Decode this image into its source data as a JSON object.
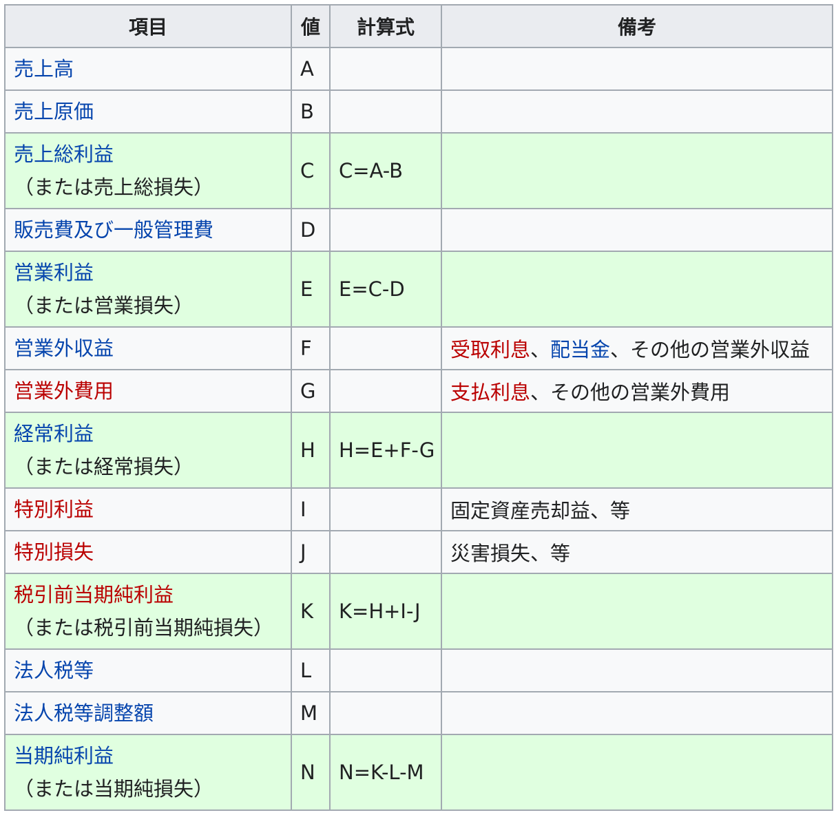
{
  "headers": {
    "item": "項目",
    "value": "値",
    "formula": "計算式",
    "note": "備考"
  },
  "rows": [
    {
      "item": "売上高",
      "item_color": "blue",
      "sub": "",
      "value": "A",
      "formula": "",
      "profit": false
    },
    {
      "item": "売上原価",
      "item_color": "blue",
      "sub": "",
      "value": "B",
      "formula": "",
      "profit": false
    },
    {
      "item": "売上総利益",
      "item_color": "blue",
      "sub": "（または売上総損失）",
      "value": "C",
      "formula": "C=A-B",
      "profit": true
    },
    {
      "item": "販売費及び一般管理費",
      "item_color": "blue",
      "sub": "",
      "value": "D",
      "formula": "",
      "profit": false
    },
    {
      "item": "営業利益",
      "item_color": "blue",
      "sub": "（または営業損失）",
      "value": "E",
      "formula": "E=C-D",
      "profit": true
    },
    {
      "item": "営業外収益",
      "item_color": "blue",
      "sub": "",
      "value": "F",
      "formula": "",
      "profit": false,
      "note": {
        "link1": "受取利息",
        "sep1": "、",
        "link2": "配当金",
        "rest": "、その他の営業外収益"
      }
    },
    {
      "item": "営業外費用",
      "item_color": "red",
      "sub": "",
      "value": "G",
      "formula": "",
      "profit": false,
      "note": {
        "link1": "支払利息",
        "rest": "、その他の営業外費用"
      }
    },
    {
      "item": "経常利益",
      "item_color": "blue",
      "sub": "（または経常損失）",
      "value": "H",
      "formula": "H=E+F-G",
      "profit": true
    },
    {
      "item": "特別利益",
      "item_color": "red",
      "sub": "",
      "value": "I",
      "formula": "",
      "profit": false,
      "note": {
        "rest": "固定資産売却益、等"
      }
    },
    {
      "item": "特別損失",
      "item_color": "red",
      "sub": "",
      "value": "J",
      "formula": "",
      "profit": false,
      "note": {
        "rest": "災害損失、等"
      }
    },
    {
      "item": "税引前当期純利益",
      "item_color": "red",
      "sub": "（または税引前当期純損失）",
      "value": "K",
      "formula": "K=H+I-J",
      "profit": true
    },
    {
      "item": "法人税等",
      "item_color": "blue",
      "sub": "",
      "value": "L",
      "formula": "",
      "profit": false
    },
    {
      "item": "法人税等調整額",
      "item_color": "blue",
      "sub": "",
      "value": "M",
      "formula": "",
      "profit": false
    },
    {
      "item": "当期純利益",
      "item_color": "blue",
      "sub": "（または当期純損失）",
      "value": "N",
      "formula": "N=K-L-M",
      "profit": true
    }
  ],
  "colors": {
    "link_blue": "#0645ad",
    "link_red": "#ba0000",
    "profit_bg": "#e0ffe0",
    "header_bg": "#eaecf0",
    "border": "#a2a9b1"
  }
}
